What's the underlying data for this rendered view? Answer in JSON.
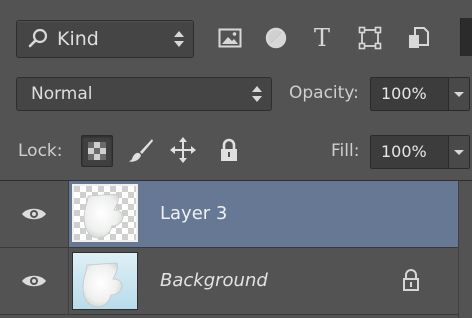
{
  "filter": {
    "kind_label": "Kind",
    "icons": [
      "pixel-filter-icon",
      "adjustment-filter-icon",
      "type-filter-icon",
      "shape-filter-icon",
      "smart-object-filter-icon"
    ],
    "type_glyph": "T"
  },
  "blend": {
    "mode": "Normal",
    "opacity_label": "Opacity:",
    "opacity_value": "100%"
  },
  "lock": {
    "label": "Lock:",
    "fill_label": "Fill:",
    "fill_value": "100%",
    "icons": [
      "lock-transparent-pixels-icon",
      "lock-image-pixels-icon",
      "lock-position-icon",
      "lock-all-icon"
    ]
  },
  "layers": [
    {
      "name": "Layer 3",
      "visible": true,
      "selected": true,
      "locked": false
    },
    {
      "name": "Background",
      "visible": true,
      "selected": false,
      "locked": true
    }
  ],
  "colors": {
    "panel": "#535353",
    "selected_row": "#677894",
    "field": "#454545"
  }
}
